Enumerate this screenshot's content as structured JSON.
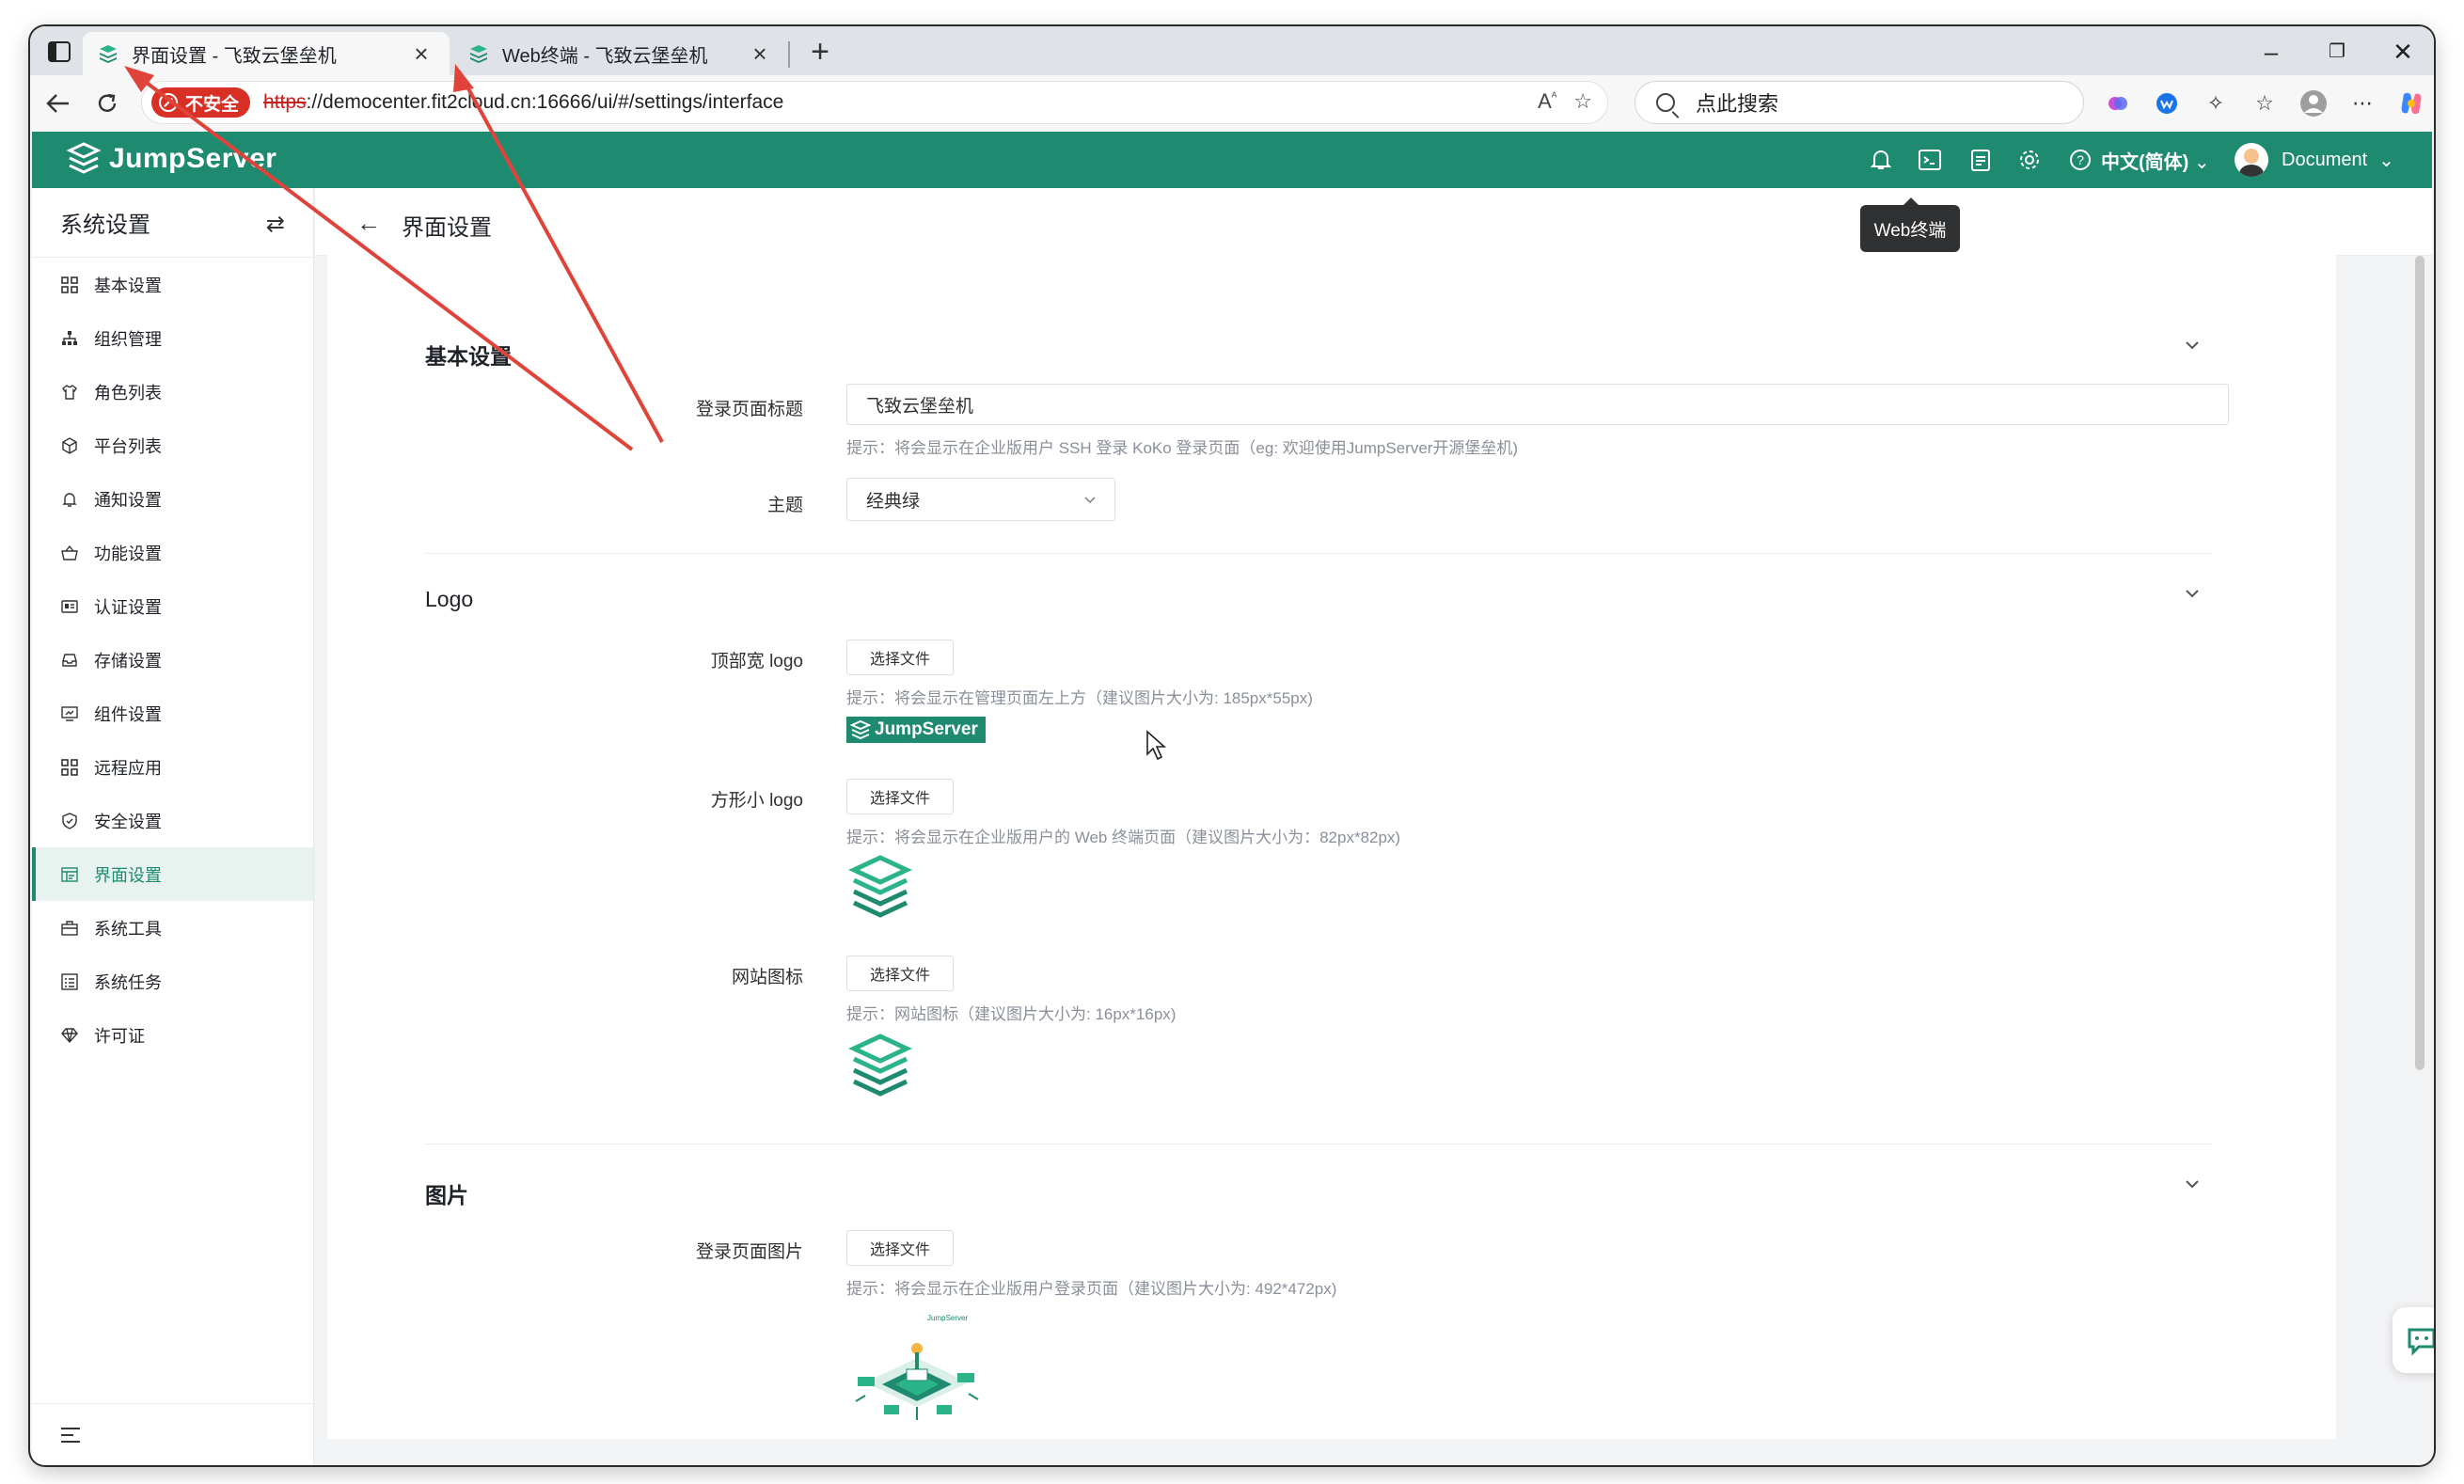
{
  "browser": {
    "tabs": [
      {
        "title": "界面设置 - 飞致云堡垒机",
        "active": true
      },
      {
        "title": "Web终端 - 飞致云堡垒机",
        "active": false
      }
    ],
    "security_badge": "不安全",
    "url_protocol": "https",
    "url_rest": "://democenter.fit2cloud.cn:16666/ui/#/settings/interface",
    "search_placeholder": "点此搜索"
  },
  "app": {
    "logo_text": "JumpServer",
    "language": "中文(简体)",
    "user": "Document",
    "tooltip": "Web终端",
    "brand_color": "#1e8a6f"
  },
  "sidebar": {
    "title": "系统设置",
    "items": [
      {
        "label": "基本设置",
        "icon": "grid-icon"
      },
      {
        "label": "组织管理",
        "icon": "org-icon"
      },
      {
        "label": "角色列表",
        "icon": "shirt-icon"
      },
      {
        "label": "平台列表",
        "icon": "cube-icon"
      },
      {
        "label": "通知设置",
        "icon": "bell-icon"
      },
      {
        "label": "功能设置",
        "icon": "basket-icon"
      },
      {
        "label": "认证设置",
        "icon": "id-card-icon"
      },
      {
        "label": "存储设置",
        "icon": "storage-icon"
      },
      {
        "label": "组件设置",
        "icon": "monitor-icon"
      },
      {
        "label": "远程应用",
        "icon": "apps-icon"
      },
      {
        "label": "安全设置",
        "icon": "shield-icon"
      },
      {
        "label": "界面设置",
        "icon": "layout-icon",
        "active": true
      },
      {
        "label": "系统工具",
        "icon": "toolbox-icon"
      },
      {
        "label": "系统任务",
        "icon": "task-icon"
      },
      {
        "label": "许可证",
        "icon": "diamond-icon"
      }
    ]
  },
  "page": {
    "title": "界面设置",
    "sections": {
      "basic": {
        "title": "基本设置",
        "login_title_label": "登录页面标题",
        "login_title_value": "飞致云堡垒机",
        "login_title_hint": "提示：将会显示在企业版用户 SSH 登录 KoKo 登录页面（eg: 欢迎使用JumpServer开源堡垒机)",
        "theme_label": "主题",
        "theme_value": "经典绿"
      },
      "logo": {
        "title": "Logo",
        "wide_logo_label": "顶部宽 logo",
        "wide_logo_hint": "提示：将会显示在管理页面左上方（建议图片大小为: 185px*55px)",
        "square_logo_label": "方形小 logo",
        "square_logo_hint": "提示：将会显示在企业版用户的 Web 终端页面（建议图片大小为：82px*82px)",
        "favicon_label": "网站图标",
        "favicon_hint": "提示：网站图标（建议图片大小为: 16px*16px)",
        "choose_file": "选择文件",
        "wide_logo_text": "JumpServer"
      },
      "images": {
        "title": "图片",
        "login_image_label": "登录页面图片",
        "login_image_hint": "提示：将会显示在企业版用户登录页面（建议图片大小为: 492*472px)",
        "login_image_caption": "JumpServer"
      }
    }
  }
}
